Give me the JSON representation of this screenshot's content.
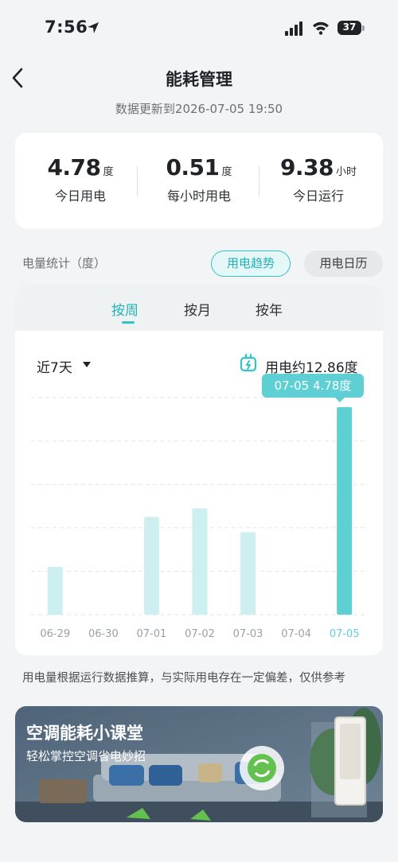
{
  "status_bar": {
    "time": "7:56",
    "battery": "37"
  },
  "header": {
    "title": "能耗管理",
    "update_text": "数据更新到2026-07-05 19:50"
  },
  "stats": [
    {
      "value": "4.78",
      "unit": "度",
      "label": "今日用电"
    },
    {
      "value": "0.51",
      "unit": "度",
      "label": "每小时用电"
    },
    {
      "value": "9.38",
      "unit": "小时",
      "label": "今日运行"
    }
  ],
  "section": {
    "label": "电量统计（度）",
    "trend_button": "用电趋势",
    "calendar_button": "用电日历"
  },
  "tabs": [
    "按周",
    "按月",
    "按年"
  ],
  "chart_header": {
    "range": "近7天",
    "total": "用电约12.86度",
    "tooltip": "07-05 4.78度"
  },
  "chart_data": {
    "type": "bar",
    "categories": [
      "06-29",
      "06-30",
      "07-01",
      "07-02",
      "07-03",
      "07-04",
      "07-05"
    ],
    "values": [
      1.1,
      0,
      2.25,
      2.45,
      1.9,
      0,
      4.78
    ],
    "ylim": [
      0,
      5.0
    ],
    "grid": true,
    "highlight_index": 6,
    "colors": {
      "bar": "#cdeff0",
      "highlight": "#5ed0d3",
      "axis_label": "#9aa0a6",
      "axis_label_highlight": "#5ed0d3"
    }
  },
  "disclaimer": "用电量根据运行数据推算，与实际用电存在一定偏差，仅供参考",
  "banner": {
    "title": "空调能耗小课堂",
    "subtitle": "轻松掌控空调省电妙招"
  },
  "colors": {
    "accent": "#2ec4c8",
    "background": "#f3f4f6"
  }
}
